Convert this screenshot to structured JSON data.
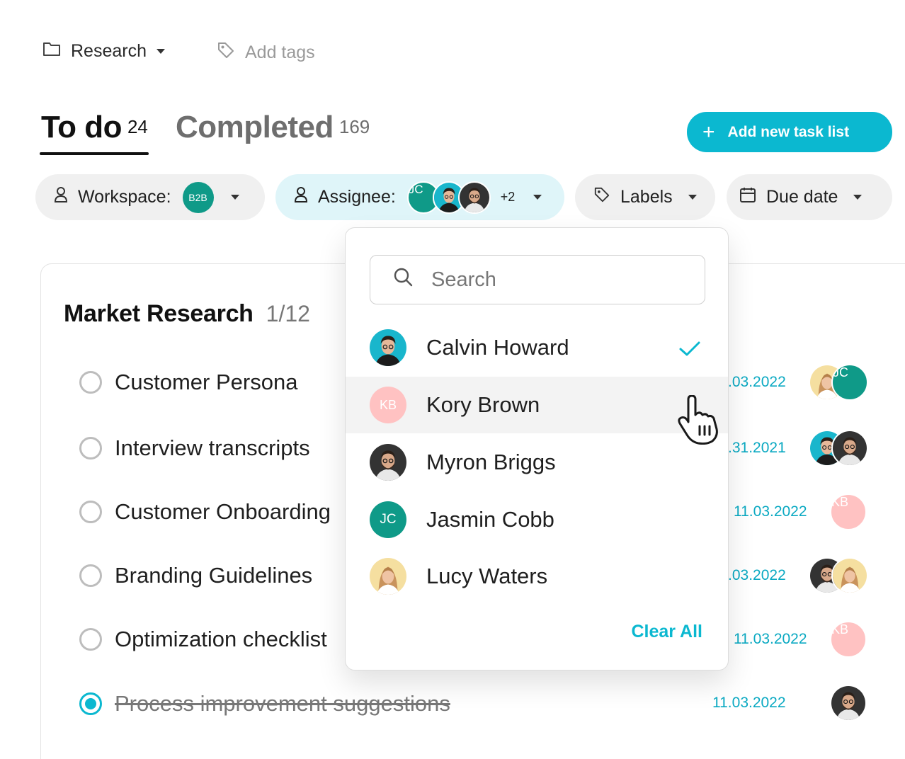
{
  "topbar": {
    "folder_icon": "folder-icon",
    "folder_name": "Research",
    "tag_icon": "tag-icon",
    "add_tags": "Add tags"
  },
  "tabs": {
    "todo_label": "To do",
    "todo_count": "24",
    "completed_label": "Completed",
    "completed_count": "169"
  },
  "add_button": {
    "icon": "plus-icon",
    "label": "Add new task list"
  },
  "filters": {
    "workspace": {
      "label": "Workspace:",
      "badge": "B2B",
      "icon": "user-icon"
    },
    "assignee": {
      "label": "Assignee:",
      "badge_initials": "JC",
      "extra": "+2",
      "icon": "user-icon"
    },
    "labels": {
      "label": "Labels",
      "icon": "tag-icon"
    },
    "due_date": {
      "label": "Due date",
      "icon": "calendar-icon"
    }
  },
  "section": {
    "title": "Market Research",
    "count": "1/12"
  },
  "tasks": [
    {
      "name": "Customer Persona",
      "due": ".03.2022",
      "done": false
    },
    {
      "name": "Interview transcripts",
      "due": ".31.2021",
      "done": false
    },
    {
      "name": "Customer Onboarding",
      "due": "11.03.2022",
      "done": false,
      "initials": "KB"
    },
    {
      "name": "Branding Guidelines",
      "due": ".03.2022",
      "done": false
    },
    {
      "name": "Optimization checklist",
      "due": "11.03.2022",
      "done": false,
      "initials": "KB"
    },
    {
      "name": "Process improvement suggestions",
      "due": "11.03.2022",
      "done": true
    }
  ],
  "task_avatar_initials": {
    "row1_second": "JC"
  },
  "dropdown": {
    "search_placeholder": "Search",
    "items": [
      {
        "name": "Calvin Howard",
        "selected": true
      },
      {
        "name": "Kory Brown",
        "initials": "KB",
        "selected": false
      },
      {
        "name": "Myron Briggs",
        "selected": false
      },
      {
        "name": "Jasmin Cobb",
        "initials": "JC",
        "selected": false
      },
      {
        "name": "Lucy Waters",
        "selected": false
      }
    ],
    "clear_all": "Clear All"
  },
  "colors": {
    "accent": "#0bb8d0",
    "teal_badge": "#0f9a88",
    "pink_badge": "#ffc2c2",
    "chip_bg": "#f0f0f0",
    "chip_active_bg": "#dff5f9"
  }
}
